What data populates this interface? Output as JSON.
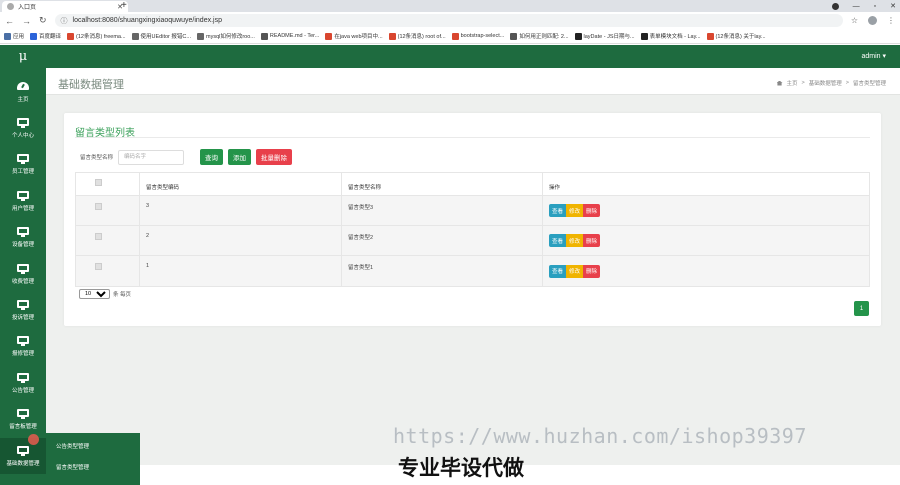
{
  "browser": {
    "tab_title": "入口页",
    "new_tab_glyph": "+",
    "url": "localhost:8080/shuangxingxiaoquwuye/index.jsp",
    "bookmarks": [
      {
        "label": "应用",
        "color": "#4a6fa5"
      },
      {
        "label": "百度翻译",
        "color": "#2b63d9"
      },
      {
        "label": "(12条消息) freema...",
        "color": "#d9462f"
      },
      {
        "label": "使用UEditor 报错C...",
        "color": "#666666"
      },
      {
        "label": "mysql如何修改roo...",
        "color": "#666666"
      },
      {
        "label": "README.md - Ter...",
        "color": "#555555"
      },
      {
        "label": "在java web项目中...",
        "color": "#d9462f"
      },
      {
        "label": "(12条消息) root of...",
        "color": "#d9462f"
      },
      {
        "label": "bootstrap-select...",
        "color": "#d9462f"
      },
      {
        "label": "如何用正则匹配: 2...",
        "color": "#555555"
      },
      {
        "label": "layDate - JS日期与...",
        "color": "#222222"
      },
      {
        "label": "表单模块文档 - Lay...",
        "color": "#222222"
      },
      {
        "label": "(12条消息) 关于lay...",
        "color": "#d9462f"
      }
    ]
  },
  "app": {
    "logo": "μ",
    "user": "admin ▾",
    "accent": "#1e6b3f"
  },
  "sidebar": {
    "items": [
      {
        "label": "主页",
        "icon": "dashboard-icon"
      },
      {
        "label": "个人中心",
        "icon": "monitor-icon"
      },
      {
        "label": "员工管理",
        "icon": "monitor-icon"
      },
      {
        "label": "用户管理",
        "icon": "monitor-icon"
      },
      {
        "label": "设备管理",
        "icon": "monitor-icon"
      },
      {
        "label": "收费管理",
        "icon": "monitor-icon"
      },
      {
        "label": "投诉管理",
        "icon": "monitor-icon"
      },
      {
        "label": "报修管理",
        "icon": "monitor-icon"
      },
      {
        "label": "公告管理",
        "icon": "monitor-icon"
      },
      {
        "label": "留言板管理",
        "icon": "monitor-icon"
      },
      {
        "label": "基础数据管理",
        "icon": "monitor-icon"
      }
    ],
    "submenu": [
      "公告类型管理",
      "留言类型管理"
    ]
  },
  "page": {
    "title": "基础数据管理",
    "breadcrumb": [
      "主页",
      ">",
      "基础数据管理",
      ">",
      "留言类型管理"
    ]
  },
  "card": {
    "title": "留言类型列表",
    "search_label": "留言类型名称",
    "search_placeholder": "编码名字",
    "btn_search": "查询",
    "btn_add": "添加",
    "btn_batch_delete": "批量删除"
  },
  "table": {
    "headers": [
      "留言类型编码",
      "留言类型名称",
      "操作"
    ],
    "rows": [
      {
        "code": "3",
        "name": "留言类型3"
      },
      {
        "code": "2",
        "name": "留言类型2"
      },
      {
        "code": "1",
        "name": "留言类型1"
      }
    ],
    "actions": {
      "view": "查看",
      "edit": "修改",
      "delete": "删除"
    }
  },
  "pagination": {
    "page_size": "10",
    "per_page_label": "条 每页",
    "current_page": "1"
  },
  "watermark": {
    "url": "https://www.huzhan.com/ishop39397",
    "text": "专业毕设代做"
  }
}
